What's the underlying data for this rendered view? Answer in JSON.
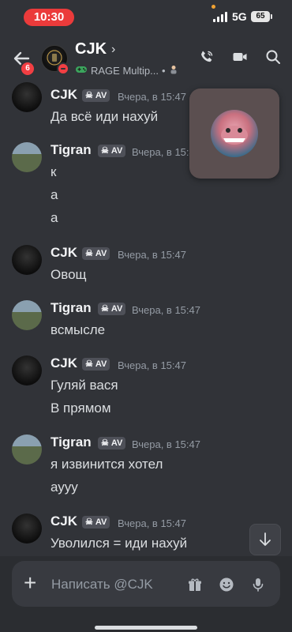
{
  "status_bar": {
    "time": "10:30",
    "network": "5G",
    "battery": "65"
  },
  "header": {
    "title": "CJK",
    "chevron": "›",
    "subtitle": "RAGE Multip...",
    "subtitle_sep": "•",
    "unread_badge": "6"
  },
  "messages": [
    {
      "author": "CJK",
      "tag": "AV",
      "time": "Вчера, в 15:47",
      "lines": [
        "Да всё иди нахуй"
      ]
    },
    {
      "author": "Tigran",
      "tag": "AV",
      "time": "Вчера, в 15:47",
      "lines": [
        "к",
        "а",
        "а"
      ]
    },
    {
      "author": "CJK",
      "tag": "AV",
      "time": "Вчера, в 15:47",
      "lines": [
        "Овощ"
      ]
    },
    {
      "author": "Tigran",
      "tag": "AV",
      "time": "Вчера, в 15:47",
      "lines": [
        "всмысле"
      ]
    },
    {
      "author": "CJK",
      "tag": "AV",
      "time": "Вчера, в 15:47",
      "lines": [
        "Гуляй вася",
        "В прямом"
      ]
    },
    {
      "author": "Tigran",
      "tag": "AV",
      "time": "Вчера, в 15:47",
      "lines": [
        "я извинится хотел",
        "аууу"
      ]
    },
    {
      "author": "CJK",
      "tag": "AV",
      "time": "Вчера, в 15:47",
      "lines": [
        "Уволился = иди нахуй"
      ]
    }
  ],
  "composer": {
    "plus": "+",
    "placeholder": "Написать @CJK"
  },
  "colors": {
    "background": "#313338",
    "composer": "#2b2d31",
    "dnd": "#f23f43",
    "status_pill": "#eb3b3b"
  }
}
